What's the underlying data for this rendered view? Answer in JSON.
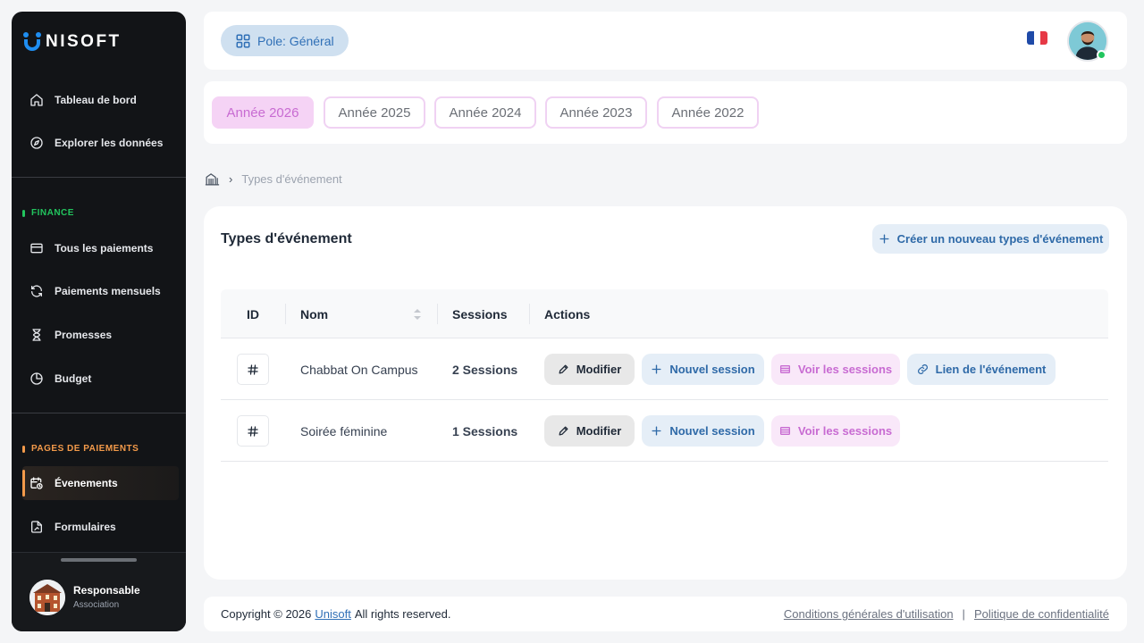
{
  "brand": {
    "name": "NISOFT",
    "logo_letter": "U",
    "color": "#1f8ef1"
  },
  "sidebar": {
    "items_top": [
      {
        "label": "Tableau de bord",
        "icon": "home-icon"
      },
      {
        "label": "Explorer les données",
        "icon": "compass-icon"
      }
    ],
    "finance": {
      "title": "FINANCE",
      "color": "#22c55e",
      "items": [
        {
          "label": "Tous les paiements",
          "icon": "credit-card-icon"
        },
        {
          "label": "Paiements mensuels",
          "icon": "refresh-icon"
        },
        {
          "label": "Promesses",
          "icon": "hourglass-icon"
        },
        {
          "label": "Budget",
          "icon": "pie-chart-icon"
        }
      ]
    },
    "payments_pages": {
      "title": "PAGES DE PAIEMENTS",
      "color": "#f39a4a",
      "items": [
        {
          "label": "Évenements",
          "icon": "calendar-clock-icon",
          "active": true
        },
        {
          "label": "Formulaires",
          "icon": "form-icon"
        }
      ]
    },
    "user": {
      "name": "Responsable",
      "role": "Association"
    }
  },
  "topbar": {
    "pole_label": "Pole: Général",
    "language": "fr"
  },
  "years": [
    {
      "label": "Année 2026",
      "active": true
    },
    {
      "label": "Année 2025"
    },
    {
      "label": "Année 2024"
    },
    {
      "label": "Année 2023"
    },
    {
      "label": "Année 2022"
    }
  ],
  "breadcrumb": {
    "current": "Types d'événement"
  },
  "card": {
    "title": "Types d'événement",
    "create_label": "Créer un nouveau types d'événement",
    "columns": {
      "id": "ID",
      "name": "Nom",
      "sessions": "Sessions",
      "actions": "Actions"
    },
    "rows": [
      {
        "name": "Chabbat On Campus",
        "sessions": "2 Sessions",
        "has_link": true
      },
      {
        "name": "Soirée féminine",
        "sessions": "1 Sessions",
        "has_link": false
      }
    ],
    "actions": {
      "edit": "Modifier",
      "new_session": "Nouvel session",
      "view_sessions": "Voir les sessions",
      "event_link": "Lien de l'événement"
    }
  },
  "footer": {
    "copyright_prefix": "Copyright © 2026",
    "company": "Unisoft",
    "copyright_suffix": "All rights reserved.",
    "terms": "Conditions générales d'utilisation",
    "separator": "|",
    "privacy": "Politique de confidentialité"
  }
}
